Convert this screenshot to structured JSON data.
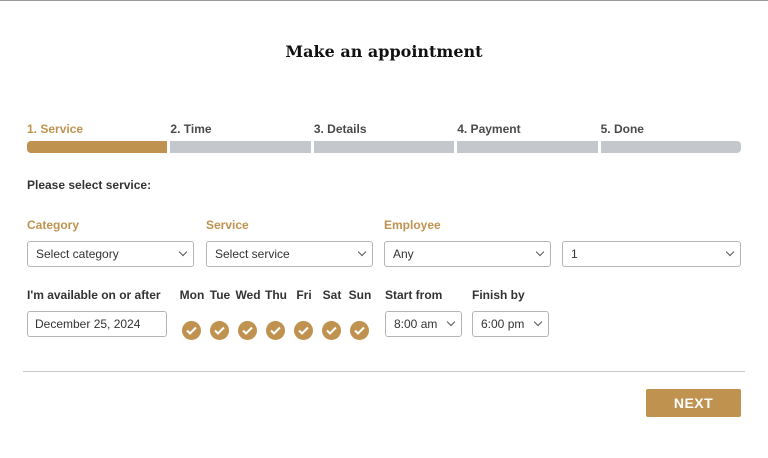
{
  "title": "Make an appointment",
  "steps": [
    {
      "label": "1. Service",
      "active": true
    },
    {
      "label": "2. Time",
      "active": false
    },
    {
      "label": "3. Details",
      "active": false
    },
    {
      "label": "4. Payment",
      "active": false
    },
    {
      "label": "5. Done",
      "active": false
    }
  ],
  "prompt": "Please select service:",
  "fields": {
    "category": {
      "label": "Category",
      "value": "Select category"
    },
    "service": {
      "label": "Service",
      "value": "Select service"
    },
    "employee": {
      "label": "Employee",
      "value": "Any"
    },
    "quantity": {
      "value": "1"
    }
  },
  "availability": {
    "label": "I'm available on or after",
    "date": "December 25, 2024",
    "days": [
      "Mon",
      "Tue",
      "Wed",
      "Thu",
      "Fri",
      "Sat",
      "Sun"
    ],
    "days_checked": [
      true,
      true,
      true,
      true,
      true,
      true,
      true
    ],
    "start_label": "Start from",
    "start_value": "8:00 am",
    "finish_label": "Finish by",
    "finish_value": "6:00 pm"
  },
  "next_label": "NEXT",
  "colors": {
    "accent": "#c0924f",
    "inactive_bar": "#c4c8cc"
  }
}
